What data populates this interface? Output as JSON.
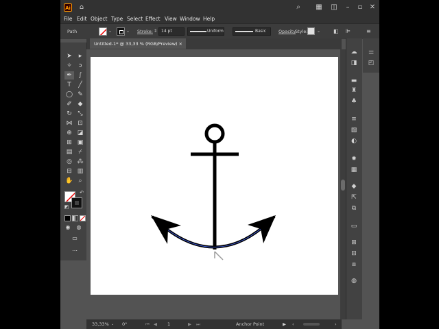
{
  "app": {
    "logo_text": "Ai",
    "icons": [
      "home-icon",
      "search-icon",
      "arrange-documents-icon",
      "workspace-icon"
    ],
    "window_controls": [
      "minimize-icon",
      "restore-icon",
      "close-icon"
    ]
  },
  "menu": {
    "items": [
      "File",
      "Edit",
      "Object",
      "Type",
      "Select",
      "Effect",
      "View",
      "Window",
      "Help"
    ]
  },
  "control_bar": {
    "selection_type": "Path",
    "stroke_label": "Stroke:",
    "stroke_weight": "14 pt",
    "profile_label": "Uniform",
    "brush_label": "Basic",
    "opacity_label": "Opacity",
    "style_label": "Style:"
  },
  "document_tab": {
    "title": "Untitled-1* @ 33,33 % (RGB/Preview)",
    "close_glyph": "×"
  },
  "status_bar": {
    "zoom": "33,33%",
    "rotation": "0°",
    "artboard_number": "1",
    "current_tool": "Anchor Point"
  },
  "colors": {
    "app_bg": "#535353",
    "chrome": "#323232",
    "artboard": "#ffffff",
    "artwork": "#000000",
    "selection_path": "#4a6cff"
  }
}
